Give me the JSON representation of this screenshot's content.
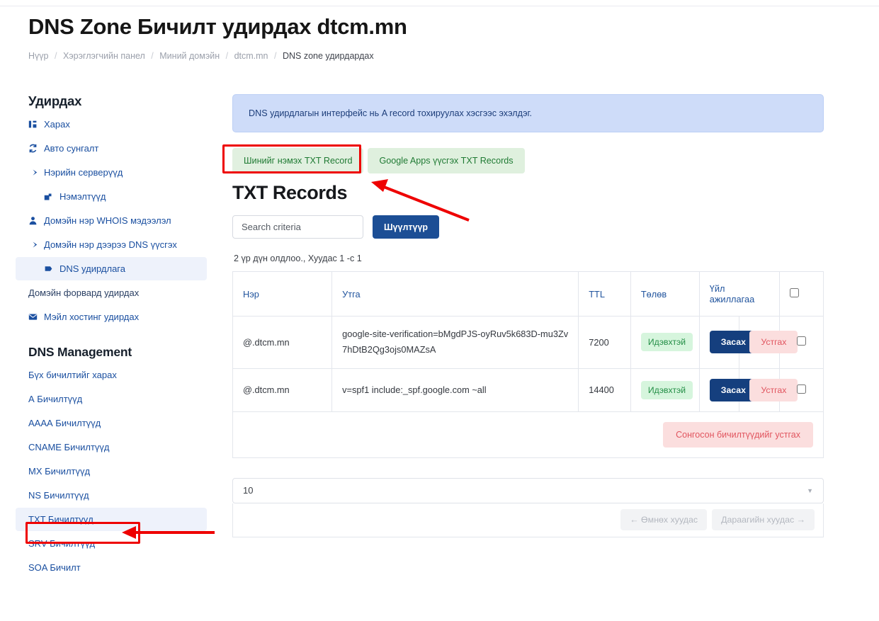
{
  "header": {
    "title": "DNS Zone Бичилт удирдах dtcm.mn",
    "breadcrumb": [
      {
        "label": "Нүүр"
      },
      {
        "label": "Хэрэглэгчийн панел"
      },
      {
        "label": "Миний домэйн"
      },
      {
        "label": "dtcm.mn"
      },
      {
        "label": "DNS zone удирдардах"
      }
    ],
    "breadcrumb_separator": "/"
  },
  "sidebar": {
    "heading": "Удирдах",
    "items": [
      {
        "label": "Харах",
        "icon": "dashboard-icon"
      },
      {
        "label": "Авто сунгалт",
        "icon": "sync-icon"
      },
      {
        "label": "Нэрийн серверүүд",
        "icon": "arrow-right-icon"
      },
      {
        "label": "Нэмэлтүүд",
        "icon": "external-link-icon"
      },
      {
        "label": "Домэйн нэр WHOIS мэдээлэл",
        "icon": "person-icon"
      },
      {
        "label": "Домэйн нэр дээрээ DNS үүсгэх",
        "icon": "arrow-right-icon"
      },
      {
        "label": "DNS удирдлага",
        "icon": "flag-icon"
      },
      {
        "label": "Домэйн форвард удирдах",
        "icon": "none"
      },
      {
        "label": "Мэйл хостинг удирдах",
        "icon": "envelope-icon"
      }
    ],
    "dns_heading": "DNS Management",
    "dns_items": [
      {
        "label": "Бүх бичилтийг харах"
      },
      {
        "label": "А Бичилтүүд"
      },
      {
        "label": "АААА Бичилтүүд"
      },
      {
        "label": "CNAME Бичилтүүд"
      },
      {
        "label": "MX Бичилтүүд"
      },
      {
        "label": "NS Бичилтүүд"
      },
      {
        "label": "TXT Бичилтүүд"
      },
      {
        "label": "SRV Бичилтүүд"
      },
      {
        "label": "SOA Бичилт"
      }
    ]
  },
  "main": {
    "alert": "DNS удирдлагын интерфейс нь A record тохируулах хэсгээс эхэлдэг.",
    "tabs": [
      {
        "label": "Шинийг нэмэх TXT Record"
      },
      {
        "label": "Google Apps үүсгэх TXT Records"
      }
    ],
    "section_title": "TXT Records",
    "search": {
      "placeholder": "Search criteria",
      "value": "",
      "button_label": "Шүүлтүүр"
    },
    "result_count": "2 үр дүн олдлоо., Хуудас 1 -с 1",
    "table": {
      "columns": [
        "Нэр",
        "Утга",
        "TTL",
        "Төлөв",
        "Үйл ажиллагаа",
        ""
      ],
      "rows": [
        {
          "name": "@.dtcm.mn",
          "value": "google-site-verification=bMgdPJS-oyRuv5k683D-mu3Zv7hDtB2Qg3ojs0MAZsA",
          "ttl": "7200",
          "state": "Идэвхтэй",
          "edit_label": "Засах",
          "delete_label": "Устгах"
        },
        {
          "name": "@.dtcm.mn",
          "value": "v=spf1 include:_spf.google.com ~all",
          "ttl": "14400",
          "state": "Идэвхтэй",
          "edit_label": "Засах",
          "delete_label": "Устгах"
        }
      ],
      "delete_selected_label": "Сонгосон бичилтүүдийг устгах"
    },
    "pagination": {
      "per_page": "10",
      "prev_label": "← Өмнөх хуудас",
      "next_label": "Дараагийн хуудас →"
    }
  },
  "colors": {
    "accent_blue": "#1c4e95",
    "link_blue": "#1a4fa0",
    "alert_bg": "#cedcf9",
    "tab_green_bg": "#dff0de",
    "tab_green_text": "#1f7a33",
    "badge_green_bg": "#d6f5dd",
    "danger_bg": "#fbdede",
    "danger_text": "#e1555f",
    "annotation_red": "#ee0000"
  }
}
